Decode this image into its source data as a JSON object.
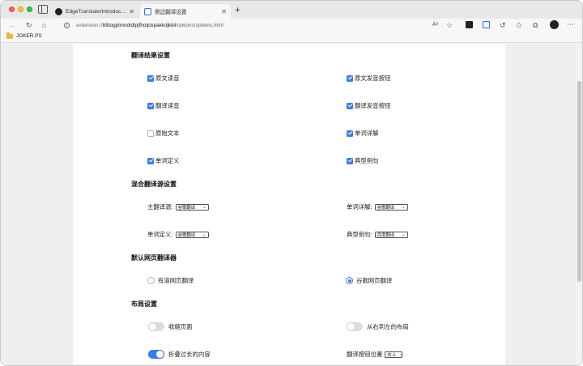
{
  "tabs": [
    {
      "title": "EdgeTranslate/Introduction.m",
      "icon": "github-icon"
    },
    {
      "title": "侧边翻译设置",
      "icon": "edge-translate-icon"
    }
  ],
  "address": {
    "scheme": "extension://",
    "host": "bfdogplmndidlpjfhoijckpakkdjkkil",
    "path": "/options/options.html"
  },
  "bookmarks": [
    {
      "label": "JOKER.PS",
      "icon": "folder-icon"
    }
  ],
  "sections": {
    "result": {
      "title": "翻译结果设置",
      "options": [
        {
          "label": "原文读音",
          "checked": true
        },
        {
          "label": "原文发音按钮",
          "checked": true
        },
        {
          "label": "翻译读音",
          "checked": true
        },
        {
          "label": "翻译发音按钮",
          "checked": true
        },
        {
          "label": "原始文本",
          "checked": false
        },
        {
          "label": "单词详解",
          "checked": true
        },
        {
          "label": "单词定义",
          "checked": true
        },
        {
          "label": "典型例句",
          "checked": true
        }
      ]
    },
    "hybrid": {
      "title": "混合翻译源设置",
      "rows": [
        {
          "label": "主翻译源:",
          "value": "谷歌翻译"
        },
        {
          "label": "单词详解:",
          "value": "谷歌翻译"
        },
        {
          "label": "单词定义:",
          "value": "谷歌翻译"
        },
        {
          "label": "典型例句:",
          "value": "百度翻译"
        }
      ]
    },
    "web": {
      "title": "默认网页翻译器",
      "options": [
        {
          "label": "有道网页翻译",
          "selected": false
        },
        {
          "label": "谷歌网页翻译",
          "selected": true
        }
      ]
    },
    "layout": {
      "title": "布局设置",
      "toggles": [
        {
          "label": "收缩页面",
          "on": false
        },
        {
          "label": "从右到左的布局",
          "on": false
        },
        {
          "label": "折叠过长的内容",
          "on": true
        }
      ],
      "button_position": {
        "label": "翻译按钮位置",
        "value": "右上"
      }
    }
  }
}
